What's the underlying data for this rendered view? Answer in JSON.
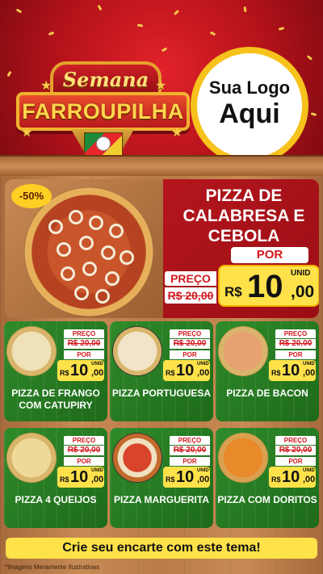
{
  "colors": {
    "red": "#c11a22",
    "green": "#2f8b2a",
    "yellow": "#ffe24a",
    "gold": "#f6c21b"
  },
  "header": {
    "title_top": "Semana",
    "title_main": "FARROUPILHA",
    "logo_line1": "Sua Logo",
    "logo_line2": "Aqui"
  },
  "featured": {
    "discount": "-50%",
    "name": "PIZZA DE CALABRESA E CEBOLA",
    "price_label": "PREÇO",
    "old_price": "R$ 20,00",
    "por_label": "POR",
    "currency": "R$",
    "price_int": "10",
    "price_dec": ",00",
    "unit": "UNID"
  },
  "products": [
    {
      "name": "PIZZA DE FRANGO COM CATUPIRY",
      "price_label": "PREÇO",
      "old_price": "R$ 20,00",
      "por_label": "POR",
      "currency": "R$",
      "price_int": "10",
      "price_dec": ",00",
      "unit": "UNID"
    },
    {
      "name": "PIZZA PORTUGUESA",
      "price_label": "PREÇO",
      "old_price": "R$ 20,00",
      "por_label": "POR",
      "currency": "R$",
      "price_int": "10",
      "price_dec": ",00",
      "unit": "UNID"
    },
    {
      "name": "PIZZA DE BACON",
      "price_label": "PREÇO",
      "old_price": "R$ 20,00",
      "por_label": "POR",
      "currency": "R$",
      "price_int": "10",
      "price_dec": ",00",
      "unit": "UNID"
    },
    {
      "name": "PIZZA 4 QUEIJOS",
      "price_label": "PREÇO",
      "old_price": "R$ 20,00",
      "por_label": "POR",
      "currency": "R$",
      "price_int": "10",
      "price_dec": ",00",
      "unit": "UNID"
    },
    {
      "name": "PIZZA MARGUERITA",
      "price_label": "PREÇO",
      "old_price": "R$ 20,00",
      "por_label": "POR",
      "currency": "R$",
      "price_int": "10",
      "price_dec": ",00",
      "unit": "UNID"
    },
    {
      "name": "PIZZA COM DORITOS",
      "price_label": "PREÇO",
      "old_price": "R$ 20,00",
      "por_label": "POR",
      "currency": "R$",
      "price_int": "10",
      "price_dec": ",00",
      "unit": "UNID"
    }
  ],
  "cta": "Crie seu encarte com este tema!",
  "footnote": "*Imagens Meramente Ilustrativas"
}
